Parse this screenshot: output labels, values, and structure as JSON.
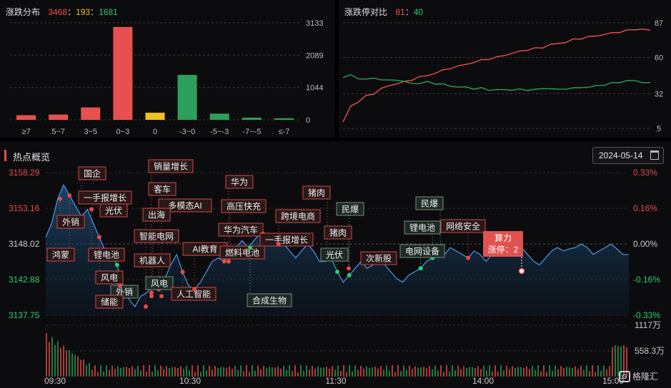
{
  "distribution": {
    "title": "涨跌分布",
    "up": "3468",
    "flat": "193",
    "down": "1681",
    "sep": "：",
    "chart_data": {
      "type": "bar",
      "categories": [
        "≥7",
        "5~7",
        "3~5",
        "0~3",
        "0",
        "-3~0",
        "-5~-3",
        "-7~-5",
        "≤-7"
      ],
      "values": [
        150,
        170,
        400,
        3000,
        230,
        1450,
        200,
        70,
        50
      ],
      "ylim": [
        0,
        3133
      ],
      "yticks": [
        "3133",
        "2089",
        "1044",
        "0"
      ],
      "colors": [
        "#e8504f",
        "#e8504f",
        "#e8504f",
        "#e8504f",
        "#f0c020",
        "#2ca05a",
        "#2ca05a",
        "#2ca05a",
        "#2ca05a"
      ]
    }
  },
  "ratio": {
    "title": "涨跌停对比",
    "up": "81",
    "down": "40",
    "chart_data": {
      "type": "line",
      "yticks": [
        "87",
        "60",
        "32",
        "5"
      ],
      "ylim": [
        5,
        87
      ],
      "series": [
        {
          "color": "#e8504f",
          "values": [
            10,
            22,
            26,
            30,
            32,
            36,
            38,
            40,
            41,
            43,
            45,
            46,
            48,
            50,
            52,
            53,
            55,
            56,
            58,
            59,
            60,
            62,
            63,
            65,
            66,
            67,
            68,
            70,
            71,
            72,
            74,
            75,
            76,
            77,
            78,
            79,
            80,
            81,
            82,
            82,
            81
          ]
        },
        {
          "color": "#2ca05a",
          "values": [
            45,
            46,
            44,
            43,
            44,
            43,
            42,
            43,
            41,
            40,
            40,
            41,
            40,
            39,
            38,
            37,
            37,
            36,
            36,
            35,
            35,
            35,
            35,
            35,
            35,
            35,
            36,
            36,
            35,
            36,
            36,
            37,
            37,
            38,
            39,
            40,
            41,
            42,
            42,
            41,
            40
          ]
        }
      ]
    }
  },
  "hot": {
    "title": "热点概览",
    "date": "2024-05-14",
    "calendar_icon": "calendar-icon",
    "chart_data": {
      "type": "area",
      "yticks_left": [
        "3158.29",
        "3153.16",
        "3148.02",
        "3142.88",
        "3137.75"
      ],
      "yticks_right": [
        "0.33%",
        "0.16%",
        "0.00%",
        "-0.16%",
        "-0.33%"
      ],
      "ylim": [
        3137.75,
        3158.29
      ],
      "vol_ticks": [
        "1117万",
        "558.3万"
      ],
      "xticks": [
        "09:30",
        "10:30",
        "11:30",
        "14:00",
        "15:00"
      ],
      "series": [
        {
          "values": [
            3149,
            3151,
            3154.5,
            3156.5,
            3155,
            3153.5,
            3152,
            3153,
            3151,
            3149,
            3147,
            3146.5,
            3145,
            3142,
            3140,
            3139,
            3140.5,
            3141,
            3142,
            3141.5,
            3143,
            3145,
            3146.5,
            3144,
            3142,
            3141.5,
            3142.5,
            3144,
            3145.5,
            3146,
            3145.5,
            3146.5,
            3147.5,
            3148.5,
            3147.5,
            3148.5,
            3149.5,
            3148.5,
            3148,
            3149,
            3148,
            3147,
            3146,
            3147,
            3148,
            3147,
            3145.5,
            3145.5,
            3146,
            3144,
            3142.5,
            3143.5,
            3144.5,
            3145.5,
            3144.5,
            3145,
            3146,
            3145,
            3144,
            3143,
            3142.5,
            3143.5,
            3144,
            3144.5,
            3145.5,
            3146,
            3147,
            3146.5,
            3147.5,
            3147,
            3146.5,
            3146,
            3147,
            3146.5,
            3145.5,
            3146.5,
            3147,
            3147.5,
            3148,
            3148.2,
            3147.5,
            3146.5,
            3145.5,
            3145,
            3146,
            3147,
            3147.5,
            3147,
            3147.3,
            3147.5,
            3148,
            3147.5,
            3146.5,
            3147,
            3147.5,
            3148,
            3147.3,
            3146.5,
            3146.5
          ]
        }
      ]
    },
    "tags": [
      "国企",
      "一手报增长",
      "外销",
      "光伏",
      "鸿蒙",
      "锂电池",
      "风电",
      "外销",
      "储能",
      "销量增长",
      "客车",
      "多模态AI",
      "出海",
      "智能电网",
      "机器人",
      "风电",
      "人工智能",
      "AI教育",
      "华为",
      "高压快充",
      "华为汽车",
      "燃料电池",
      "一手报增长",
      "跨境电商",
      "合成生物",
      "猪肉",
      "光伏",
      "民爆",
      "猪肉",
      "次新股",
      "民爆",
      "锂电池",
      "网络安全",
      "电网设备"
    ],
    "callout": {
      "name": "算力",
      "stat": "涨停：2"
    }
  },
  "brand": {
    "name": "格隆汇",
    "mark": "G"
  }
}
